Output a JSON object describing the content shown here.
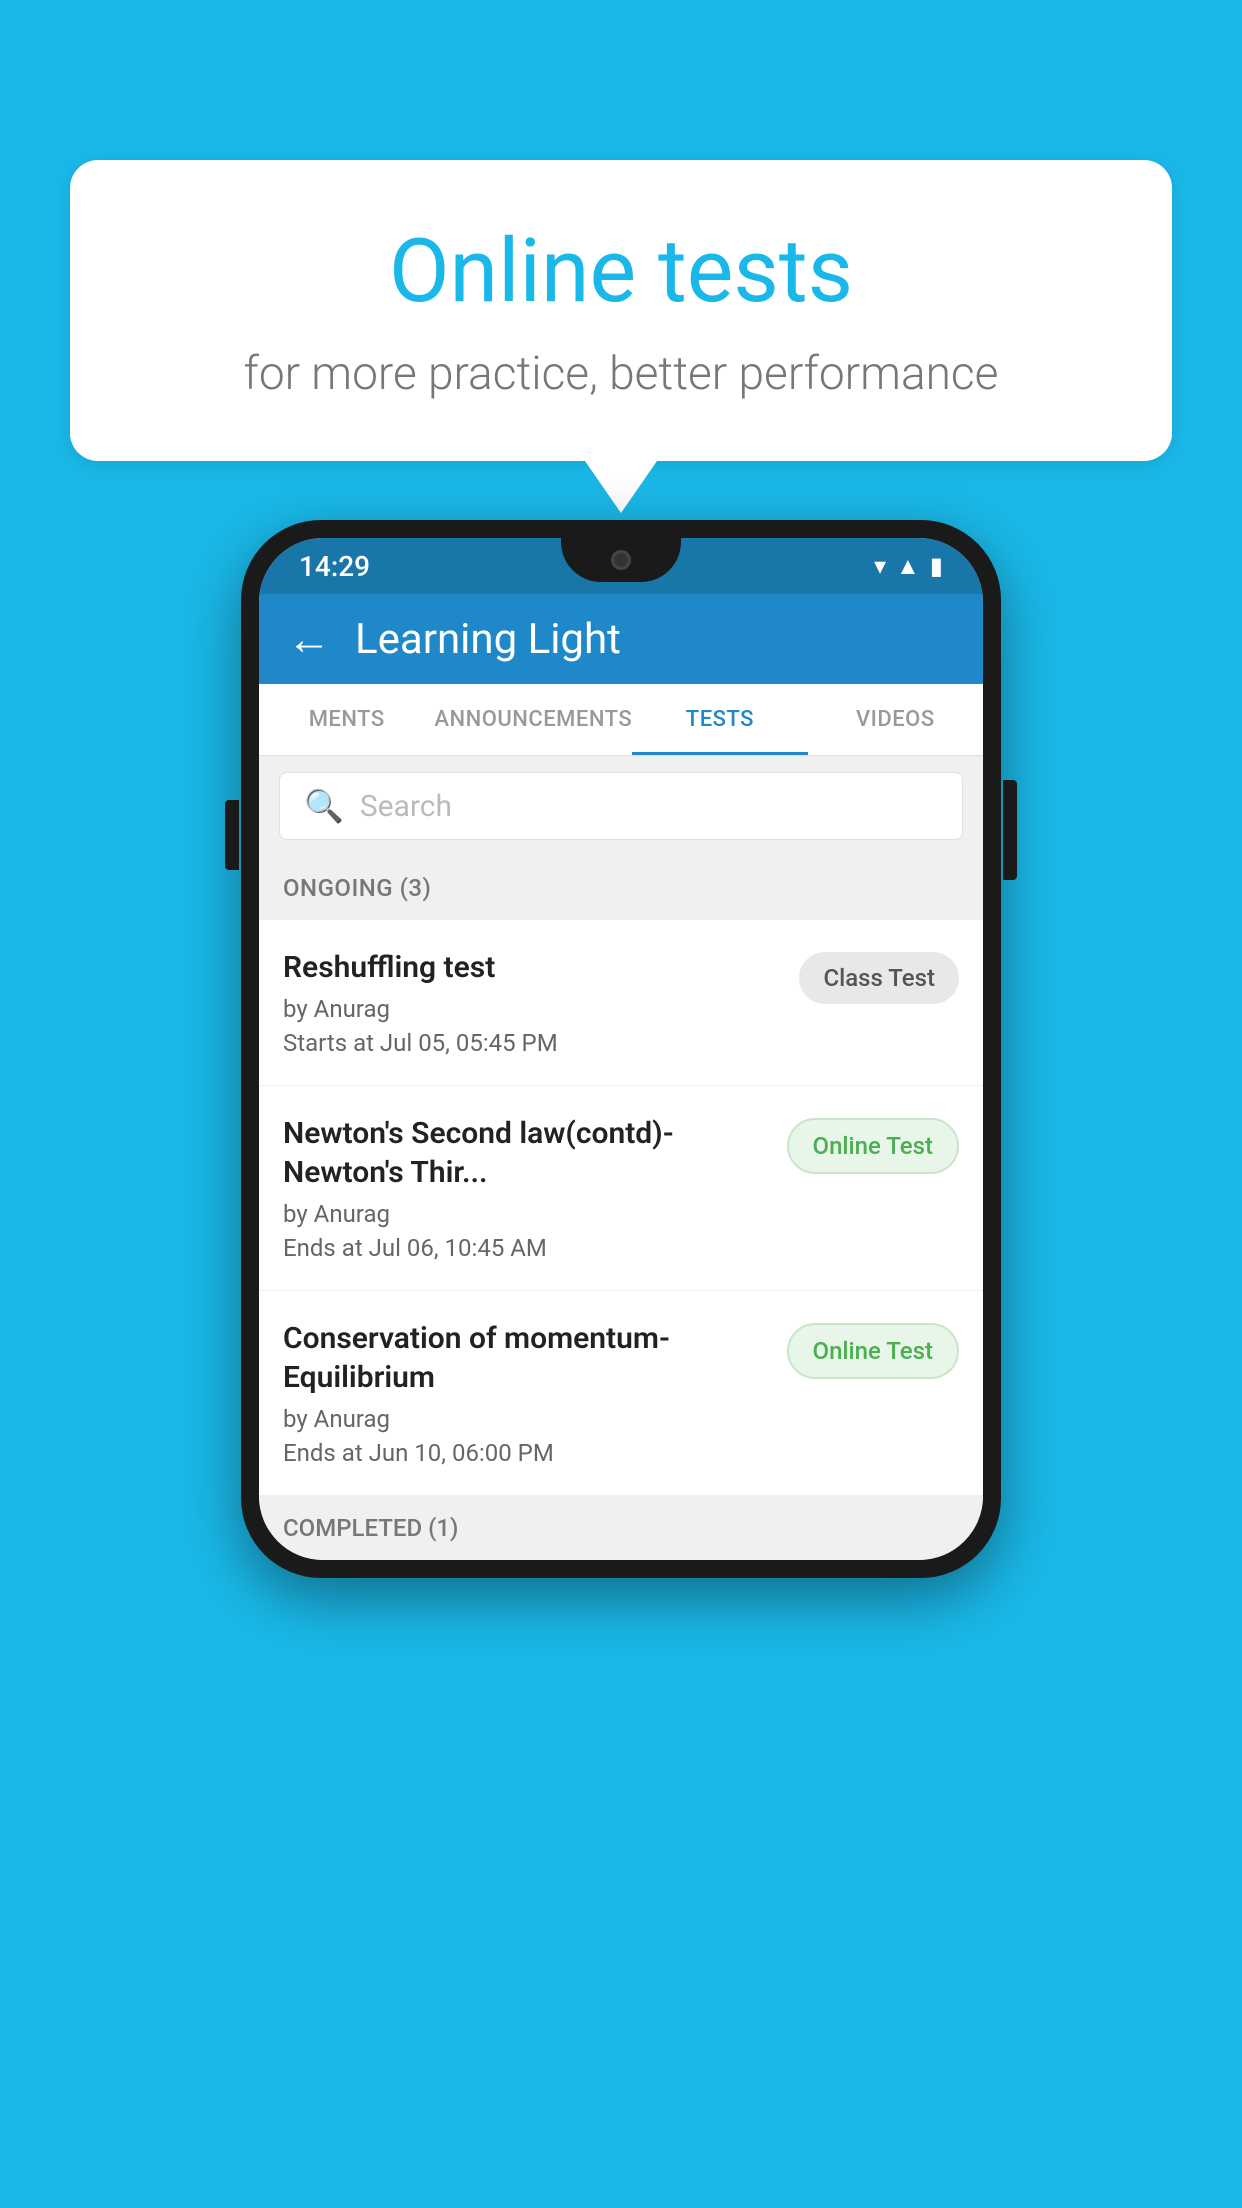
{
  "background": {
    "color": "#1ab8e8"
  },
  "bubble": {
    "title": "Online tests",
    "subtitle": "for more practice, better performance"
  },
  "phone": {
    "statusBar": {
      "time": "14:29",
      "icons": [
        "wifi",
        "signal",
        "battery"
      ]
    },
    "appBar": {
      "title": "Learning Light",
      "backLabel": "←"
    },
    "tabs": [
      {
        "label": "MENTS",
        "active": false
      },
      {
        "label": "ANNOUNCEMENTS",
        "active": false
      },
      {
        "label": "TESTS",
        "active": true
      },
      {
        "label": "VIDEOS",
        "active": false
      }
    ],
    "search": {
      "placeholder": "Search"
    },
    "sections": [
      {
        "title": "ONGOING (3)",
        "tests": [
          {
            "title": "Reshuffling test",
            "author": "by Anurag",
            "time": "Starts at  Jul 05, 05:45 PM",
            "badge": "Class Test",
            "badgeType": "class"
          },
          {
            "title": "Newton's Second law(contd)-Newton's Thir...",
            "author": "by Anurag",
            "time": "Ends at  Jul 06, 10:45 AM",
            "badge": "Online Test",
            "badgeType": "online"
          },
          {
            "title": "Conservation of momentum-Equilibrium",
            "author": "by Anurag",
            "time": "Ends at  Jun 10, 06:00 PM",
            "badge": "Online Test",
            "badgeType": "online"
          }
        ]
      },
      {
        "title": "COMPLETED (1)",
        "tests": []
      }
    ]
  }
}
